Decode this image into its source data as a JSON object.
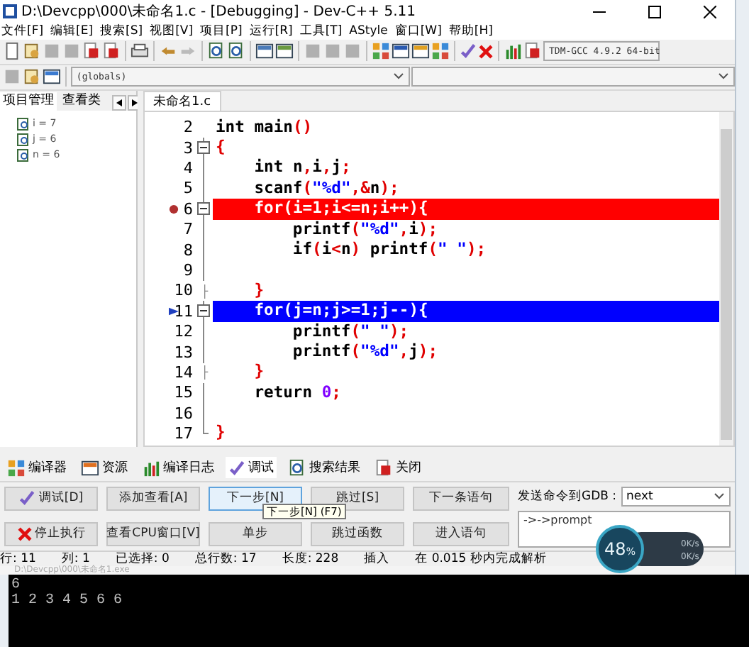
{
  "window": {
    "title": "D:\\Devcpp\\000\\未命名1.c - [Debugging] - Dev-C++ 5.11"
  },
  "menu": [
    "文件[F]",
    "编辑[E]",
    "搜索[S]",
    "视图[V]",
    "项目[P]",
    "运行[R]",
    "工具[T]",
    "AStyle",
    "窗口[W]",
    "帮助[H]"
  ],
  "compiler_select": {
    "value": "TDM-GCC 4.9.2 64-bit"
  },
  "scope_select": {
    "value": "(globals)"
  },
  "side_tabs": [
    {
      "label": "项目管理",
      "selected": true
    },
    {
      "label": "查看类",
      "selected": false
    }
  ],
  "watches": [
    {
      "label": "i = 7"
    },
    {
      "label": "j = 6"
    },
    {
      "label": "n = 6"
    }
  ],
  "editor_tabs": [
    {
      "label": "未命名1.c",
      "selected": true
    }
  ],
  "code_lines": [
    {
      "number": "2",
      "text": "int main()",
      "kind": "plain",
      "breakpoint": false,
      "current": false
    },
    {
      "number": "3",
      "text": "{",
      "kind": "fold-start",
      "breakpoint": false,
      "current": false
    },
    {
      "number": "4",
      "text": "    int n,i,j;",
      "kind": "fold-line",
      "breakpoint": false,
      "current": false
    },
    {
      "number": "5",
      "text": "    scanf(\"%d\",&n);",
      "kind": "fold-line",
      "breakpoint": false,
      "current": false
    },
    {
      "number": "6",
      "text": "    for(i=1;i<=n;i++){",
      "kind": "fold-start",
      "breakpoint": true,
      "current": false
    },
    {
      "number": "7",
      "text": "        printf(\"%d\",i);",
      "kind": "fold-line",
      "breakpoint": false,
      "current": false
    },
    {
      "number": "8",
      "text": "        if(i<n) printf(\" \");",
      "kind": "fold-line",
      "breakpoint": false,
      "current": false
    },
    {
      "number": "9",
      "kind": "fold-line",
      "breakpoint": false,
      "current": false
    },
    {
      "number": "10",
      "text": "    }",
      "kind": "fold-tick",
      "breakpoint": false,
      "current": false
    },
    {
      "number": "11",
      "text": "    for(j=n;j>=1;j--){",
      "kind": "fold-start",
      "breakpoint": false,
      "current": true
    },
    {
      "number": "12",
      "text": "        printf(\" \");",
      "kind": "fold-line",
      "breakpoint": false,
      "current": false
    },
    {
      "number": "13",
      "text": "        printf(\"%d\",j);",
      "kind": "fold-line",
      "breakpoint": false,
      "current": false
    },
    {
      "number": "14",
      "text": "    }",
      "kind": "fold-tick",
      "breakpoint": false,
      "current": false
    },
    {
      "number": "15",
      "text": "    return 0;",
      "kind": "fold-line",
      "breakpoint": false,
      "current": false
    },
    {
      "number": "16",
      "kind": "fold-line",
      "breakpoint": false,
      "current": false
    },
    {
      "number": "17",
      "text": "}",
      "kind": "fold-end",
      "breakpoint": false,
      "current": false
    }
  ],
  "bottom_tabs": [
    {
      "label": "编译器",
      "selected": false
    },
    {
      "label": "资源",
      "selected": false
    },
    {
      "label": "编译日志",
      "selected": false
    },
    {
      "label": "调试",
      "selected": true
    },
    {
      "label": "搜索结果",
      "selected": false
    },
    {
      "label": "关闭",
      "selected": false
    }
  ],
  "debug_buttons": [
    {
      "label": "调试[D]",
      "kind": "check",
      "hovered": false
    },
    {
      "label": "添加查看[A]",
      "kind": "plain",
      "hovered": false
    },
    {
      "label": "下一步[N]",
      "kind": "plain",
      "hovered": true
    },
    {
      "label": "跳过[S]",
      "kind": "plain",
      "hovered": false
    },
    {
      "label": "下一条语句",
      "kind": "plain",
      "hovered": false
    },
    {
      "label": "停止执行",
      "kind": "stop",
      "hovered": false
    },
    {
      "label": "查看CPU窗口[V]",
      "kind": "plain",
      "hovered": false
    },
    {
      "label": "单步",
      "kind": "plain",
      "hovered": false
    },
    {
      "label": "跳过函数",
      "kind": "plain",
      "hovered": false
    },
    {
      "label": "进入语句",
      "kind": "plain",
      "hovered": false
    }
  ],
  "tooltip": "下一步[N] (F7)",
  "gdb": {
    "label": "发送命令到GDB :",
    "command": "next",
    "output": "->->prompt"
  },
  "status_bar": [
    {
      "label": "行:",
      "value": "11"
    },
    {
      "label": "列:",
      "value": "1"
    },
    {
      "label": "已选择:",
      "value": "0"
    },
    {
      "label": "总行数:",
      "value": "17"
    },
    {
      "label": "长度:",
      "value": "228"
    }
  ],
  "status_mode": "插入",
  "status_message": "在 0.015 秒内完成解析",
  "speed_widget": {
    "percent": "48",
    "unit": "%",
    "upload": "0K/s",
    "download": "0K/s"
  },
  "console": {
    "title": "D:\\Devcpp\\000\\未命名1.exe",
    "lines": [
      "6",
      "1 2 3 4 5 6 6"
    ]
  }
}
